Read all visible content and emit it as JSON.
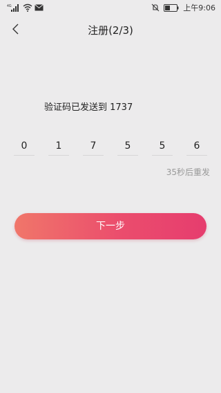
{
  "status_bar": {
    "network_label": "4G",
    "time": "上午9:06",
    "icons": [
      "signal-icon",
      "wifi-icon",
      "mail-icon",
      "mute-icon",
      "battery-icon"
    ]
  },
  "header": {
    "back_icon": "chevron-left-icon",
    "title": "注册(2/3)"
  },
  "verify": {
    "sent_to_text": "验证码已发送到 1737",
    "code_digits": [
      "0",
      "1",
      "7",
      "5",
      "5",
      "6"
    ],
    "resend_text": "35秒后重发"
  },
  "actions": {
    "next_label": "下一步"
  },
  "colors": {
    "background": "#ecebec",
    "button_gradient_start": "#f0766a",
    "button_gradient_end": "#e63d6e"
  }
}
